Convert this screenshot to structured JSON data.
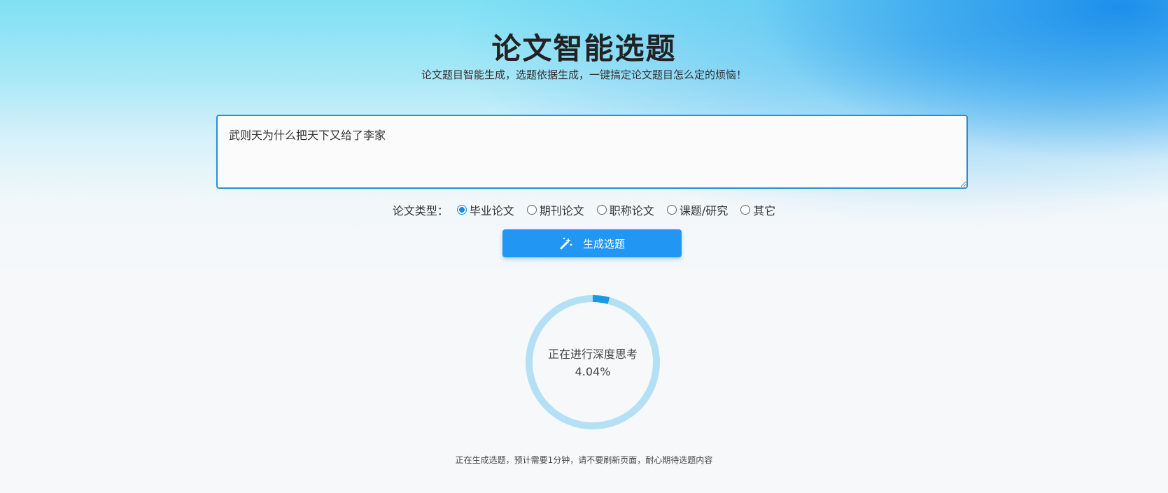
{
  "header": {
    "title": "论文智能选题",
    "subtitle": "论文题目智能生成，选题依据生成，一键搞定论文题目怎么定的烦恼！"
  },
  "topic_input": {
    "value": "武则天为什么把天下又给了李家"
  },
  "paper_type": {
    "label": "论文类型：",
    "options": [
      {
        "label": "毕业论文",
        "checked": true
      },
      {
        "label": "期刊论文",
        "checked": false
      },
      {
        "label": "职称论文",
        "checked": false
      },
      {
        "label": "课题/研究",
        "checked": false
      },
      {
        "label": "其它",
        "checked": false
      }
    ]
  },
  "generate_button": {
    "label": "生成选题",
    "icon": "magic-wand-icon"
  },
  "progress": {
    "status": "正在进行深度思考",
    "percent_text": "4.04%",
    "fraction": 0.0404,
    "track_color": "#b3e0f5",
    "fill_color": "#1a9ae0"
  },
  "footer": {
    "note": "正在生成选题，预计需要1分钟，请不要刷新页面，耐心期待选题内容"
  }
}
